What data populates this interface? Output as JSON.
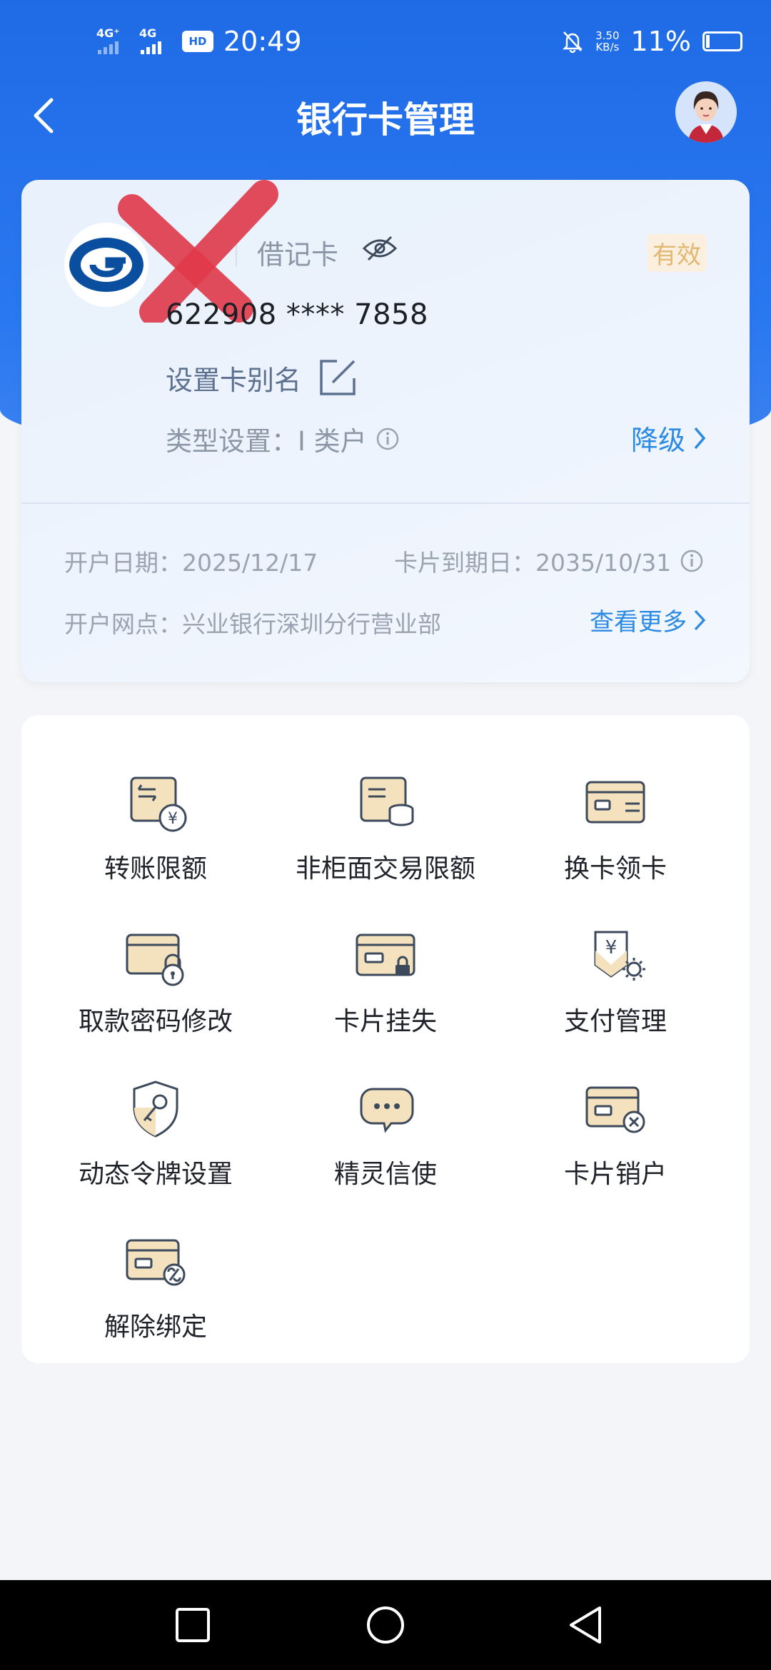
{
  "status_bar": {
    "signal1": "4G⁺",
    "signal2": "4G",
    "hd": "HD",
    "time": "20:49",
    "speed_value": "3.50",
    "speed_unit": "KB/s",
    "battery": "11%"
  },
  "nav": {
    "title": "银行卡管理"
  },
  "card": {
    "type": "借记卡",
    "status": "有效",
    "number": "622908 **** 7858",
    "alias_label": "设置卡别名",
    "type_setting": "类型设置：I 类户",
    "downgrade": "降级",
    "open_date": "开户日期：2025/12/17",
    "expire_date": "卡片到期日：2035/10/31",
    "branch": "开户网点：兴业银行深圳分行营业部",
    "more": "查看更多"
  },
  "services": [
    {
      "label": "转账限额",
      "icon": "transfer-limit-icon"
    },
    {
      "label": "非柜面交易限额",
      "icon": "non-counter-limit-icon"
    },
    {
      "label": "换卡领卡",
      "icon": "card-replace-icon"
    },
    {
      "label": "取款密码修改",
      "icon": "pin-change-icon"
    },
    {
      "label": "卡片挂失",
      "icon": "card-lock-icon"
    },
    {
      "label": "支付管理",
      "icon": "payment-settings-icon"
    },
    {
      "label": "动态令牌设置",
      "icon": "token-shield-icon"
    },
    {
      "label": "精灵信使",
      "icon": "chat-bubble-icon"
    },
    {
      "label": "卡片销户",
      "icon": "card-cancel-icon"
    },
    {
      "label": "解除绑定",
      "icon": "unbind-icon"
    }
  ],
  "colors": {
    "header_blue": "#1f6be6",
    "link_blue": "#2b8ae4",
    "badge_gold": "#e2b772",
    "icon_gold": "#e9c98b"
  }
}
